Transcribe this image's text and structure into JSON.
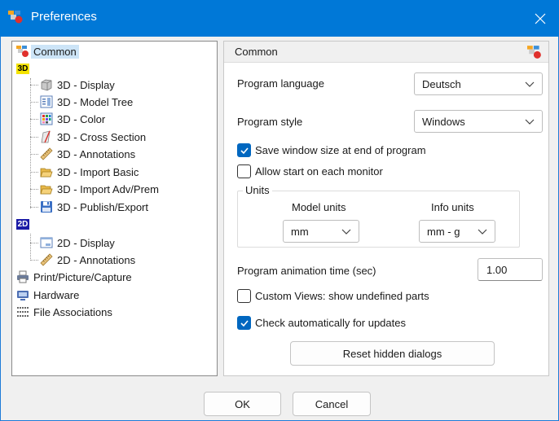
{
  "window": {
    "title": "Preferences"
  },
  "tree": {
    "items": [
      {
        "label": "Common",
        "icon": "common-prefs-icon"
      },
      {
        "label": "3D",
        "icon": "3d-badge-icon"
      },
      {
        "label": "3D - Display",
        "icon": "cube-icon"
      },
      {
        "label": "3D - Model Tree",
        "icon": "model-tree-icon"
      },
      {
        "label": "3D - Color",
        "icon": "color-palette-icon"
      },
      {
        "label": "3D - Cross Section",
        "icon": "cross-section-icon"
      },
      {
        "label": "3D - Annotations",
        "icon": "ruler-icon"
      },
      {
        "label": "3D - Import Basic",
        "icon": "folder-open-icon"
      },
      {
        "label": "3D - Import Adv/Prem",
        "icon": "folder-open-icon"
      },
      {
        "label": "3D - Publish/Export",
        "icon": "floppy-disk-icon"
      },
      {
        "label": "2D",
        "icon": "2d-badge-icon"
      },
      {
        "label": "2D - Display",
        "icon": "window-icon"
      },
      {
        "label": "2D - Annotations",
        "icon": "ruler-icon"
      },
      {
        "label": "Print/Picture/Capture",
        "icon": "printer-icon"
      },
      {
        "label": "Hardware",
        "icon": "hardware-icon"
      },
      {
        "label": "File Associations",
        "icon": "file-associations-icon"
      }
    ]
  },
  "panel": {
    "header": "Common",
    "program_language": {
      "label": "Program language",
      "value": "Deutsch"
    },
    "program_style": {
      "label": "Program style",
      "value": "Windows"
    },
    "save_window_size": {
      "label": "Save window size at end of program",
      "checked": true
    },
    "allow_start_monitor": {
      "label": "Allow start on each monitor",
      "checked": false
    },
    "units": {
      "title": "Units",
      "model_units_label": "Model units",
      "model_units_value": "mm",
      "info_units_label": "Info units",
      "info_units_value": "mm - g"
    },
    "animation_time": {
      "label": "Program animation time (sec)",
      "value": "1.00"
    },
    "custom_views": {
      "label": "Custom Views: show undefined parts",
      "checked": false
    },
    "check_updates": {
      "label": "Check automatically for updates",
      "checked": true
    },
    "reset_button": "Reset hidden dialogs"
  },
  "footer": {
    "ok": "OK",
    "cancel": "Cancel"
  },
  "colors": {
    "titlebar": "#0078d7",
    "accent": "#0067c0",
    "selection": "#cce4f7"
  }
}
